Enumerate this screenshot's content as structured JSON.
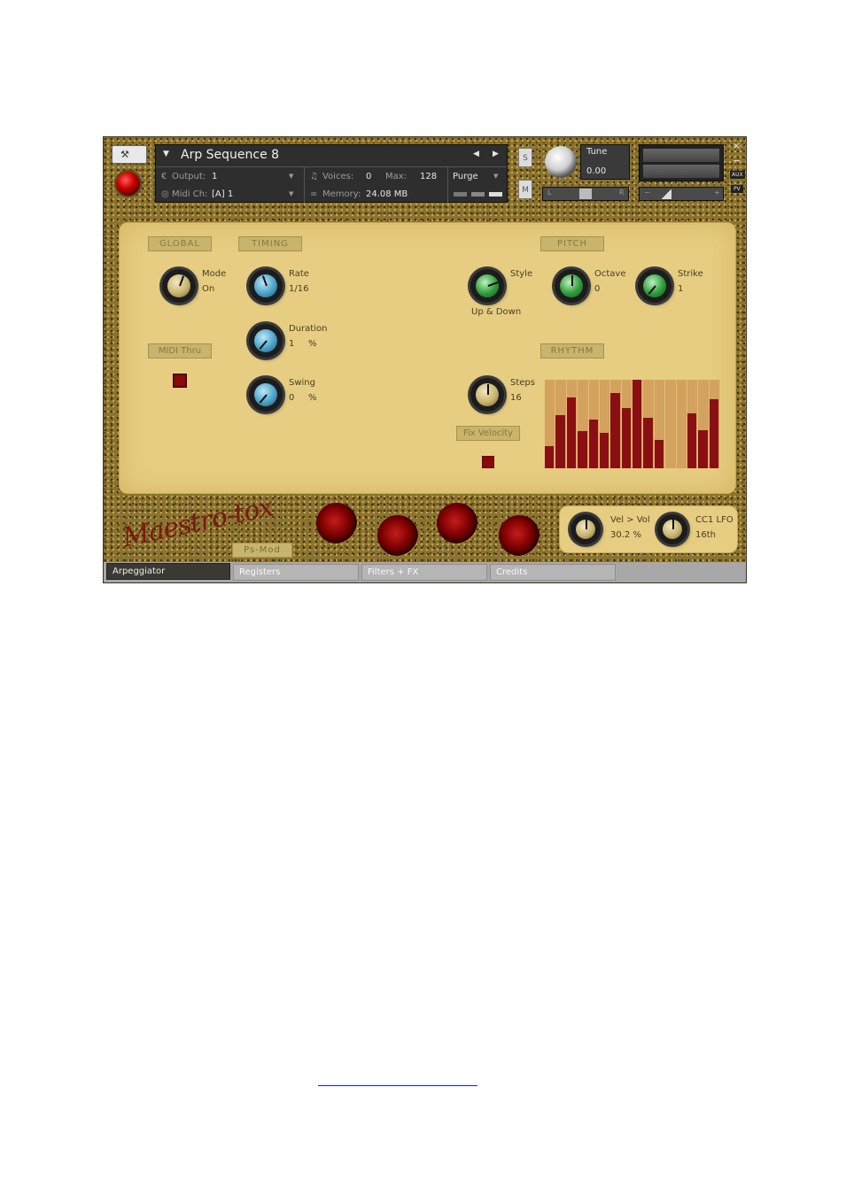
{
  "header": {
    "instrument_name": "Arp Sequence 8",
    "output_label": "Output:",
    "output_value": "1",
    "midi_label": "Midi Ch:",
    "midi_value": "[A]  1",
    "voices_label": "Voices:",
    "voices_value": "0",
    "max_label": "Max:",
    "max_value": "128",
    "memory_label": "Memory:",
    "memory_value": "24.08 MB",
    "purge_label": "Purge",
    "solo_label": "S",
    "mute_label": "M",
    "tune_label": "Tune",
    "tune_value": "0.00",
    "pan_left": "L",
    "pan_right": "R",
    "vol_minus": "−",
    "vol_plus": "+",
    "aux_label": "AUX",
    "pv_label": "PV",
    "close_label": "×",
    "minimize_label": "−"
  },
  "global": {
    "section_label": "GLOBAL",
    "mode_label": "Mode",
    "mode_value": "On",
    "midi_thru_label": "MIDI Thru"
  },
  "timing": {
    "section_label": "TIMING",
    "rate_label": "Rate",
    "rate_value": "1/16",
    "duration_label": "Duration",
    "duration_value": "1",
    "duration_unit": "%",
    "swing_label": "Swing",
    "swing_value": "0",
    "swing_unit": "%"
  },
  "pitch": {
    "section_label": "PITCH",
    "style_label": "Style",
    "style_value": "Up & Down",
    "octave_label": "Octave",
    "octave_value": "0",
    "strike_label": "Strike",
    "strike_value": "1"
  },
  "rhythm": {
    "section_label": "RHYTHM",
    "steps_label": "Steps",
    "steps_value": "16",
    "fix_velocity_label": "Fix Velocity",
    "step_levels": [
      0.25,
      0.6,
      0.8,
      0.42,
      0.55,
      0.4,
      0.85,
      0.68,
      1.0,
      0.57,
      0.32,
      0,
      0,
      0.62,
      0.43,
      0.78
    ]
  },
  "footer": {
    "logo_text": "Maestro-tox",
    "psmod_label": "Ps-Mod",
    "vel_vol_label": "Vel > Vol",
    "vel_vol_value": "30.2  %",
    "cc1_lfo_label": "CC1 LFO",
    "cc1_lfo_value": "16th"
  },
  "tabs": [
    {
      "label": "Arpeggiator"
    },
    {
      "label": "Registers"
    },
    {
      "label": "Filters + FX"
    },
    {
      "label": "Credits"
    }
  ],
  "colors": {
    "panel": "#e6cd82",
    "knob_blue": "#4aa3c8",
    "knob_green": "#2e9a3a",
    "knob_gold": "#c8b46c",
    "bar_red": "#8a0f12",
    "bar_empty": "#d2a25e"
  }
}
